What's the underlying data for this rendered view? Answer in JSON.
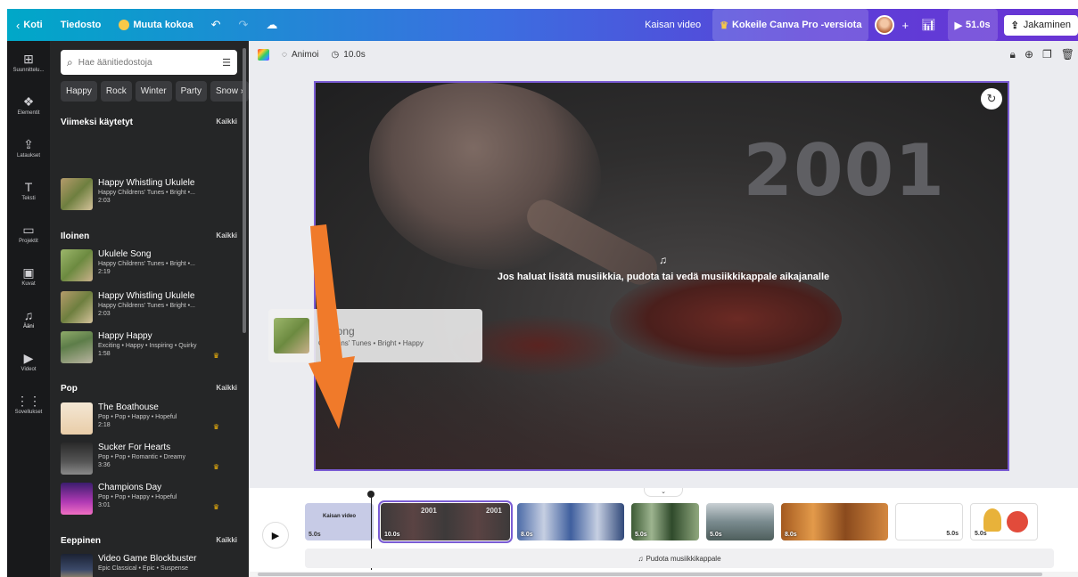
{
  "topbar": {
    "home": "Koti",
    "file": "Tiedosto",
    "resize": "Muuta kokoa",
    "project_title": "Kaisan video",
    "try_pro": "Kokeile Canva Pro -versiota",
    "play_duration": "51.0s",
    "share": "Jakaminen"
  },
  "rail": [
    {
      "icon": "layout-icon",
      "glyph": "⊞",
      "label": "Suunnittelu..."
    },
    {
      "icon": "elements-icon",
      "glyph": "❖",
      "label": "Elementit"
    },
    {
      "icon": "upload-icon",
      "glyph": "⇪",
      "label": "Lataukset"
    },
    {
      "icon": "text-icon",
      "glyph": "T",
      "label": "Teksti"
    },
    {
      "icon": "folder-icon",
      "glyph": "▭",
      "label": "Projektit"
    },
    {
      "icon": "image-icon",
      "glyph": "▣",
      "label": "Kuvat"
    },
    {
      "icon": "music-icon",
      "glyph": "♫",
      "label": "Ääni"
    },
    {
      "icon": "video-icon",
      "glyph": "▶",
      "label": "Videot"
    },
    {
      "icon": "apps-icon",
      "glyph": "⋮⋮",
      "label": "Sovellukset"
    }
  ],
  "panel": {
    "search_placeholder": "Hae äänitiedostoja",
    "chips": [
      "Happy",
      "Rock",
      "Winter",
      "Party",
      "Snow"
    ],
    "sections": {
      "recent": {
        "title": "Viimeksi käytetyt",
        "all": "Kaikki"
      },
      "cheerful": {
        "title": "Iloinen",
        "all": "Kaikki"
      },
      "pop": {
        "title": "Pop",
        "all": "Kaikki"
      },
      "epic": {
        "title": "Eeppinen",
        "all": "Kaikki"
      }
    },
    "tracks": [
      {
        "title": "Happy Whistling Ukulele",
        "tags": "Happy Childrens' Tunes • Bright •...",
        "duration": "2:03",
        "pro": false
      },
      {
        "title": "Ukulele Song",
        "tags": "Happy Childrens' Tunes • Bright •...",
        "duration": "2:19",
        "pro": false
      },
      {
        "title": "Happy Whistling Ukulele",
        "tags": "Happy Childrens' Tunes • Bright •...",
        "duration": "2:03",
        "pro": false
      },
      {
        "title": "Happy Happy",
        "tags": "Exciting • Happy • Inspiring • Quirky",
        "duration": "1:58",
        "pro": true
      },
      {
        "title": "The Boathouse",
        "tags": "Pop • Pop • Happy • Hopeful",
        "duration": "2:18",
        "pro": true
      },
      {
        "title": "Sucker For Hearts",
        "tags": "Pop • Pop • Romantic • Dreamy",
        "duration": "3:36",
        "pro": true
      },
      {
        "title": "Champions Day",
        "tags": "Pop • Pop • Happy • Hopeful",
        "duration": "3:01",
        "pro": true
      },
      {
        "title": "Video Game Blockbuster",
        "tags": "Epic Classical • Epic • Suspense",
        "duration": "",
        "pro": false
      }
    ]
  },
  "editor": {
    "animate": "Animoi",
    "duration": "10.0s",
    "year_text": "2001",
    "drop_message": "Jos haluat lisätä musiikkia, pudota tai vedä musiikkikappale aikajanalle",
    "drag_ghost": {
      "title": "le Song",
      "tags": "Childrens' Tunes • Bright • Happy"
    }
  },
  "timeline": {
    "clips": [
      {
        "label": "Kaisan video",
        "duration": "5.0s"
      },
      {
        "label": "2001",
        "duration": "10.0s"
      },
      {
        "label": "",
        "duration": "8.0s"
      },
      {
        "label": "",
        "duration": "5.0s"
      },
      {
        "label": "",
        "duration": "5.0s"
      },
      {
        "label": "",
        "duration": "8.0s"
      },
      {
        "label": "",
        "duration": "5.0s"
      },
      {
        "label": "",
        "duration": "5.0s"
      }
    ],
    "audio_drop": "Pudota musiikkikappale"
  }
}
